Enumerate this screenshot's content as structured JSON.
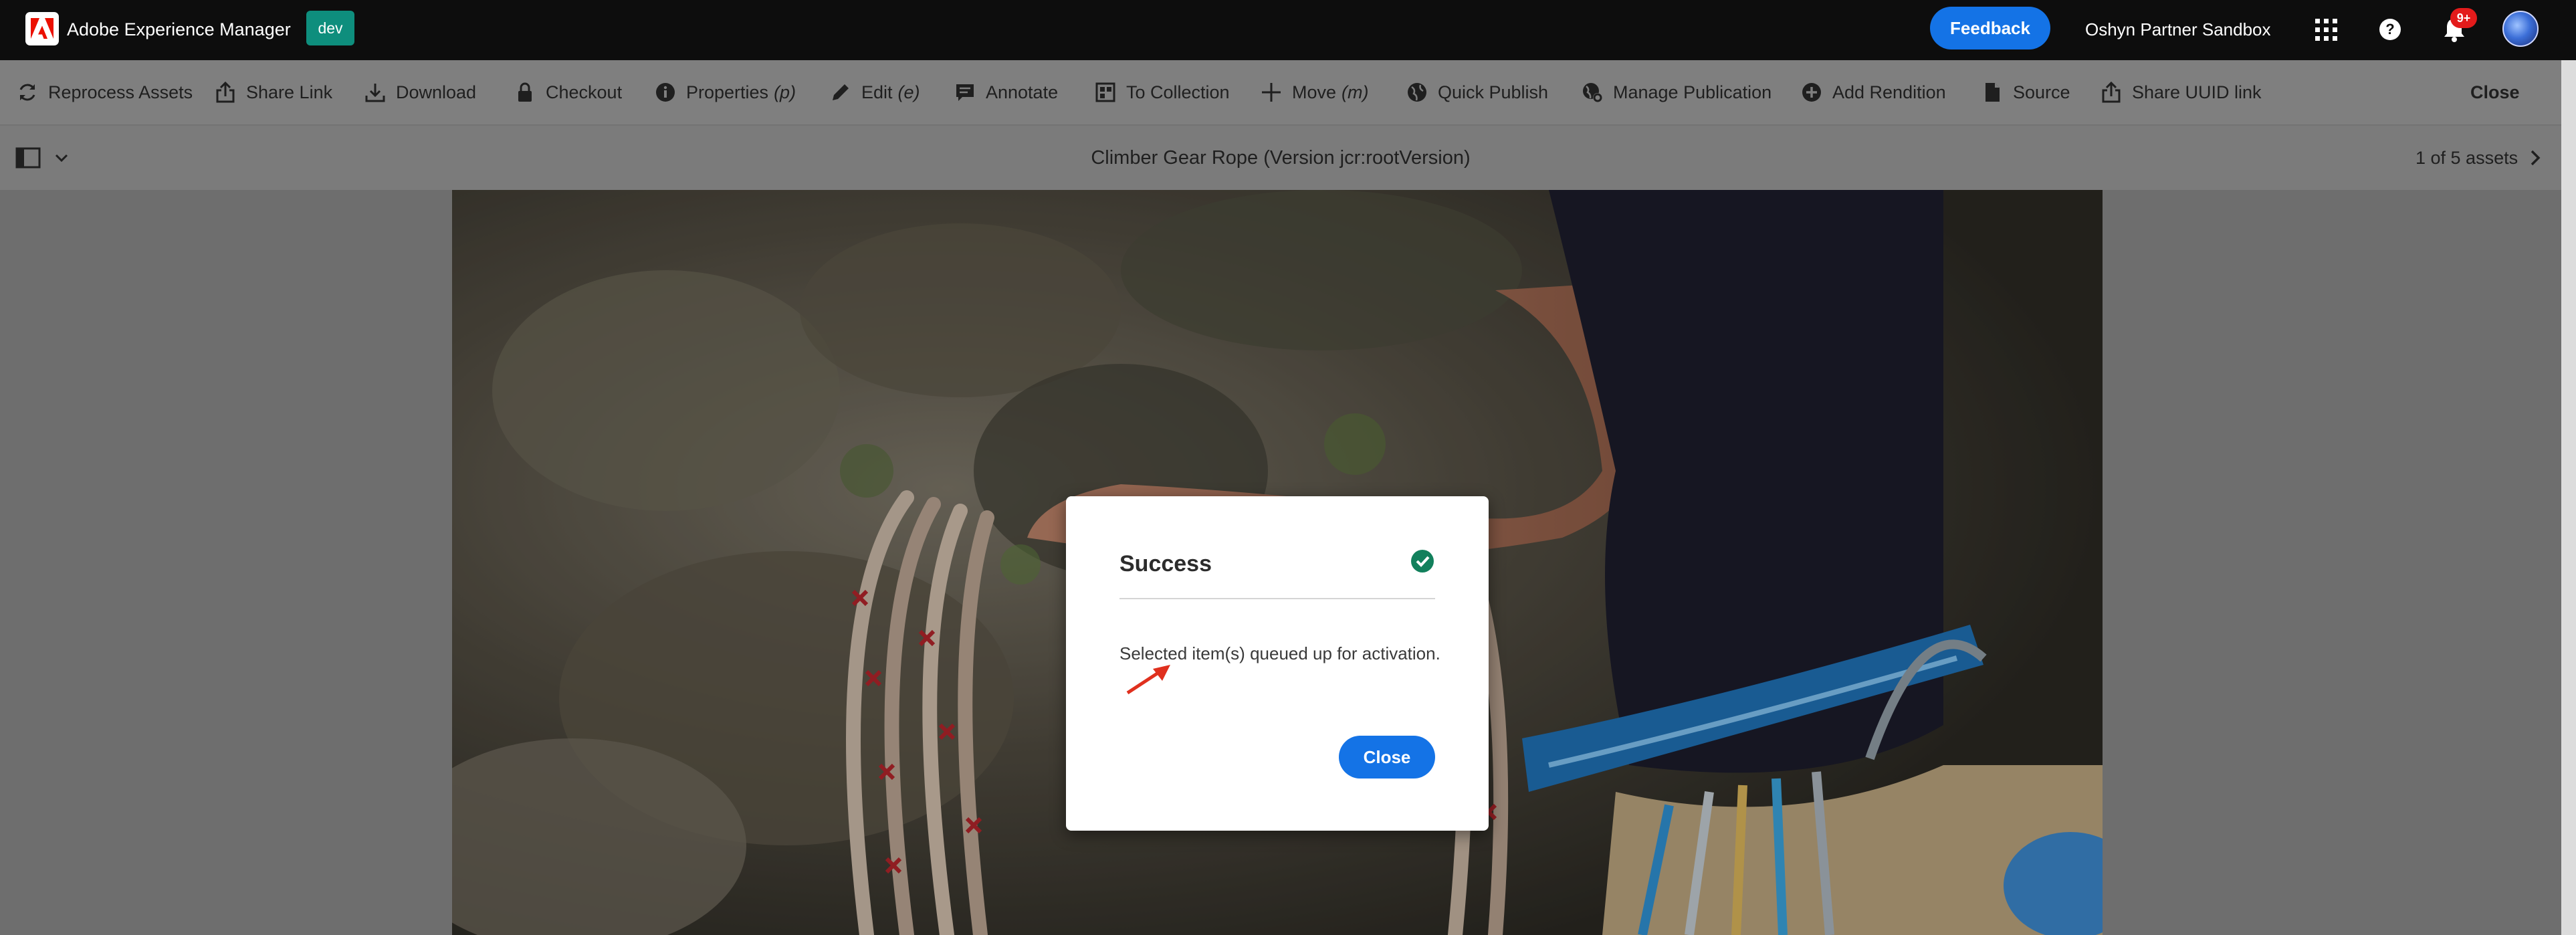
{
  "app": {
    "title": "Adobe Experience Manager",
    "environment_badge": "dev",
    "feedback_label": "Feedback",
    "org_name": "Oshyn Partner Sandbox",
    "notification_count": "9+",
    "accent_color": "#1473e6",
    "brand_color": "#eb1000"
  },
  "toolbar": {
    "actions": [
      {
        "label": "Reprocess Assets",
        "shortcut": "",
        "icon": "reprocess-icon"
      },
      {
        "label": "Share Link",
        "shortcut": "",
        "icon": "share-icon"
      },
      {
        "label": "Download",
        "shortcut": "",
        "icon": "download-icon"
      },
      {
        "label": "Checkout",
        "shortcut": "",
        "icon": "lock-icon"
      },
      {
        "label": "Properties",
        "shortcut": "(p)",
        "icon": "info-icon"
      },
      {
        "label": "Edit",
        "shortcut": "(e)",
        "icon": "pencil-icon"
      },
      {
        "label": "Annotate",
        "shortcut": "",
        "icon": "comment-icon"
      },
      {
        "label": "To Collection",
        "shortcut": "",
        "icon": "collection-icon"
      },
      {
        "label": "Move",
        "shortcut": "(m)",
        "icon": "move-icon"
      },
      {
        "label": "Quick Publish",
        "shortcut": "",
        "icon": "globe-icon"
      },
      {
        "label": "Manage Publication",
        "shortcut": "",
        "icon": "globe-gear-icon"
      },
      {
        "label": "Add Rendition",
        "shortcut": "",
        "icon": "add-circle-icon"
      },
      {
        "label": "Source",
        "shortcut": "",
        "icon": "file-icon"
      },
      {
        "label": "Share UUID link",
        "shortcut": "",
        "icon": "share-icon"
      }
    ],
    "close_label": "Close"
  },
  "header": {
    "asset_title": "Climber Gear Rope (Version jcr:rootVersion)",
    "pager_text": "1 of 5 assets"
  },
  "dialog": {
    "title": "Success",
    "message": "Selected item(s) queued up for activation.",
    "close_label": "Close",
    "status_icon": "success-check-icon",
    "status_color": "#12805c"
  }
}
